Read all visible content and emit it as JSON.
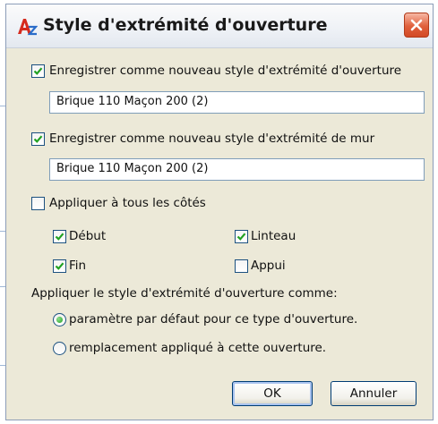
{
  "dialog": {
    "title": "Style d'extrémité d'ouverture",
    "icon": "autocad-icon",
    "close_icon": "close-icon"
  },
  "opening_style": {
    "checked": true,
    "label": "Enregistrer comme nouveau style d'extrémité d'ouverture",
    "value": "Brique 110 Maçon 200 (2)"
  },
  "wall_style": {
    "checked": true,
    "label": "Enregistrer comme nouveau style d'extrémité de mur",
    "value": "Brique 110 Maçon 200 (2)"
  },
  "apply_all": {
    "checked": false,
    "label": "Appliquer à tous les côtés"
  },
  "sides": {
    "start": {
      "checked": true,
      "label": "Début"
    },
    "header": {
      "checked": true,
      "label": "Linteau"
    },
    "end": {
      "checked": true,
      "label": "Fin"
    },
    "sill": {
      "checked": false,
      "label": "Appui"
    }
  },
  "apply_as": {
    "label": "Appliquer le style d'extrémité d'ouverture comme:",
    "options": [
      {
        "label": "paramètre par défaut pour ce type d'ouverture.",
        "selected": true
      },
      {
        "label": "remplacement appliqué à cette ouverture.",
        "selected": false
      }
    ]
  },
  "buttons": {
    "ok": "OK",
    "cancel": "Annuler"
  },
  "colors": {
    "dialog_bg": "#ece9d8",
    "check_mark": "#21a121",
    "close_red": "#e0603c"
  }
}
